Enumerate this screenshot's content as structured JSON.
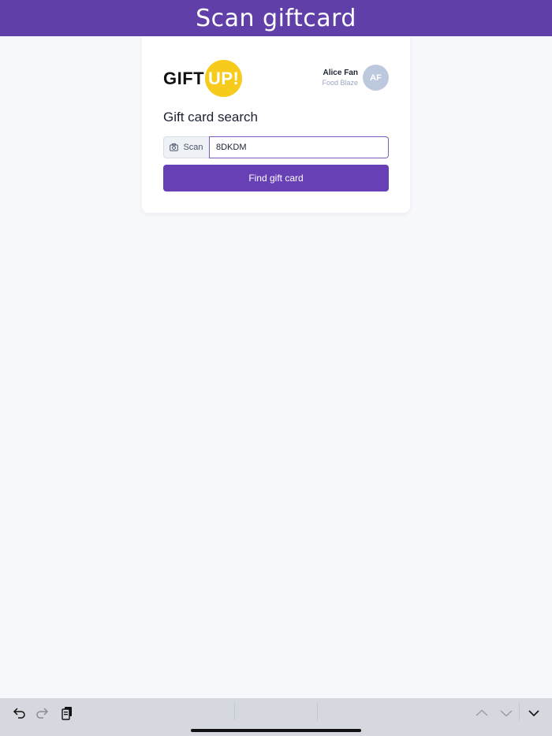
{
  "header": {
    "title": "Scan giftcard"
  },
  "logo": {
    "text_left": "GIFT",
    "text_right": "UP!",
    "brand_color": "#f7cb1b"
  },
  "user": {
    "name": "Alice Fan",
    "organization": "Food Blaze",
    "initials": "AF"
  },
  "search": {
    "title": "Gift card search",
    "scan_label": "Scan",
    "scan_icon": "camera-icon",
    "code_value": "8DKDM",
    "submit_label": "Find gift card"
  },
  "colors": {
    "header_bg": "#6040a8",
    "primary_button": "#6740b6",
    "input_focus": "#7b5bc0"
  },
  "keyboard_bar": {
    "icons": [
      "undo-icon",
      "redo-icon",
      "clipboard-paste-icon",
      "chevron-up-icon",
      "chevron-down-icon",
      "keyboard-dismiss-icon"
    ]
  }
}
